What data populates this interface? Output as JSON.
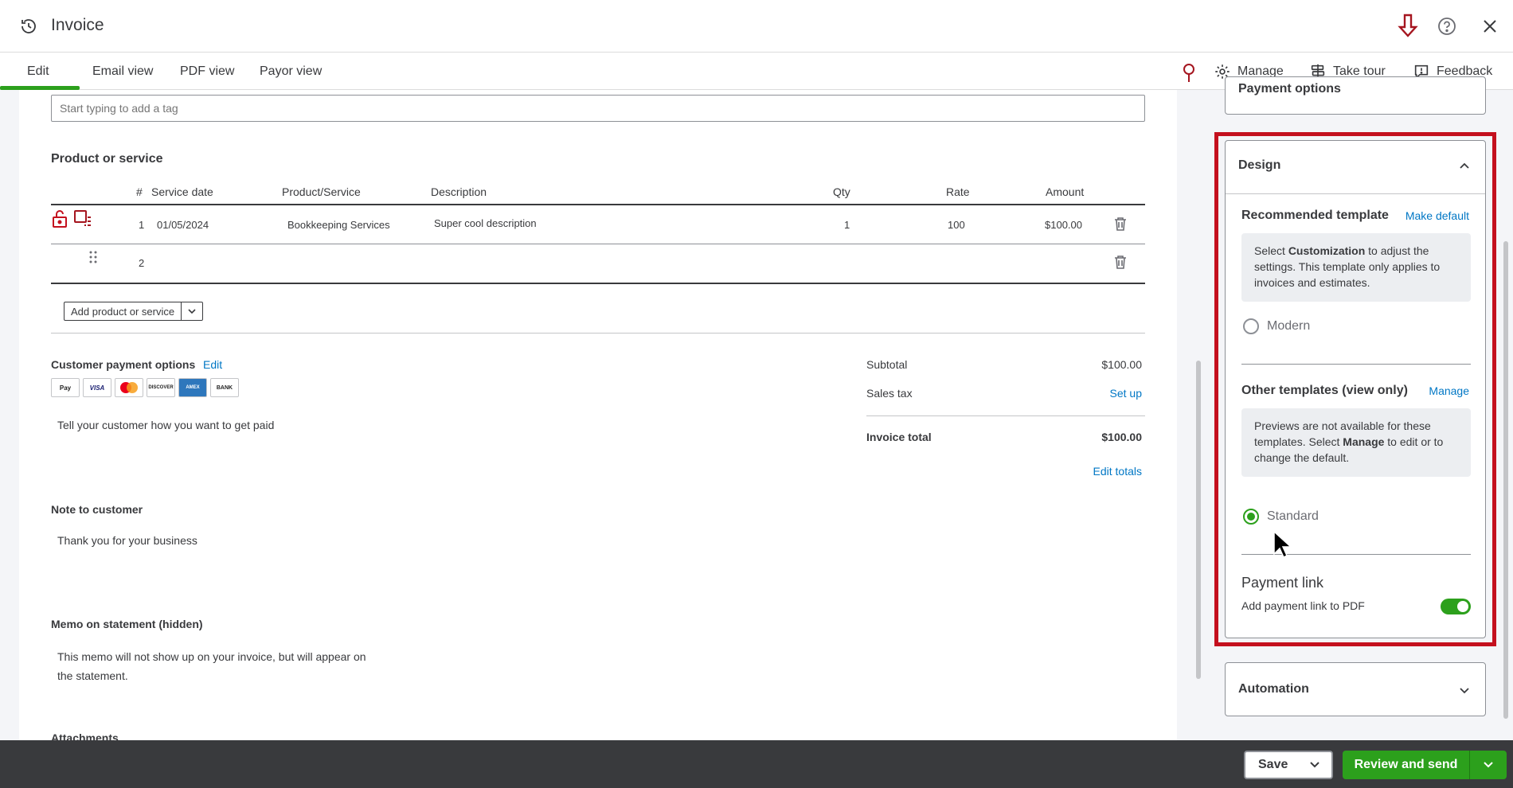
{
  "header": {
    "title": "Invoice"
  },
  "tabs": [
    {
      "label": "Edit",
      "active": true
    },
    {
      "label": "Email view"
    },
    {
      "label": "PDF view"
    },
    {
      "label": "Payor view"
    }
  ],
  "toolbar": {
    "manage_label": "Manage",
    "tour_label": "Take tour",
    "feedback_label": "Feedback"
  },
  "form": {
    "tag_placeholder": "Start typing to add a tag",
    "product_heading": "Product or service",
    "columns": [
      "#",
      "Service date",
      "Product/Service",
      "Description",
      "Qty",
      "Rate",
      "Amount"
    ],
    "rows": [
      {
        "num": "1",
        "date": "01/05/2024",
        "product": "Bookkeeping Services",
        "description": "Super cool description",
        "qty": "1",
        "rate": "100",
        "amount": "$100.00"
      },
      {
        "num": "2",
        "date": "",
        "product": "",
        "description": "",
        "qty": "",
        "rate": "",
        "amount": ""
      }
    ],
    "add_line_label": "Add product or service",
    "payment_options_label": "Customer payment options",
    "edit_label": "Edit",
    "payment_methods": [
      "Pay",
      "VISA",
      "MC",
      "DISCOVER",
      "AMEX",
      "BANK"
    ],
    "payment_prompt": "Tell your customer how you want to get paid",
    "note_label": "Note to customer",
    "note_value": "Thank you for your business",
    "memo_label": "Memo on statement (hidden)",
    "memo_value": "This memo will not show up on your invoice, but will appear on the statement.",
    "attachments_label": "Attachments"
  },
  "totals": {
    "subtotal_label": "Subtotal",
    "subtotal_value": "$100.00",
    "tax_label": "Sales tax",
    "tax_value": "Set up",
    "total_label": "Invoice total",
    "total_value": "$100.00",
    "edit_totals": "Edit totals"
  },
  "panel": {
    "payment_options_title": "Payment options",
    "design": {
      "title": "Design",
      "recommended_label": "Recommended template",
      "make_default": "Make default",
      "info_pre": "Select ",
      "info_bold": "Customization",
      "info_post": " to adjust the settings. This template only applies to invoices and estimates.",
      "modern_label": "Modern",
      "other_label": "Other templates (view only)",
      "manage_link": "Manage",
      "other_pre": "Previews are not available for these templates. Select ",
      "other_bold": "Manage",
      "other_post": " to edit or to change the default.",
      "standard_label": "Standard",
      "payment_link_title": "Payment link",
      "payment_link_label": "Add payment link to PDF",
      "payment_link_on": true
    },
    "automation_title": "Automation"
  },
  "footer": {
    "save_label": "Save",
    "review_label": "Review and send"
  },
  "colors": {
    "accent_green": "#2ca01c",
    "highlight_red": "#c4101e",
    "link_blue": "#0077c5",
    "footer_bg": "#393a3d"
  }
}
